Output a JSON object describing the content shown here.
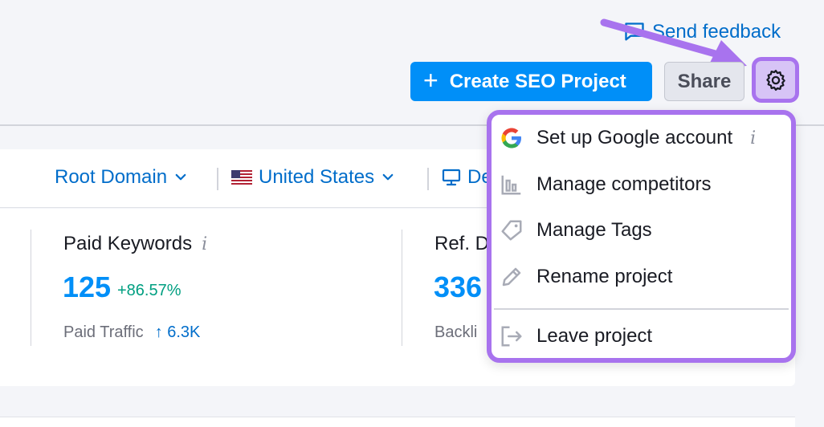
{
  "header": {
    "feedback_label": "Send feedback",
    "create_label": "Create SEO Project",
    "share_label": "Share"
  },
  "filters": {
    "root_domain": "Root Domain",
    "country": "United States",
    "device": "De"
  },
  "metrics": {
    "paid_keywords": {
      "title": "Paid Keywords",
      "info": "i",
      "value": "125",
      "change": "+86.57%",
      "sub_label": "Paid Traffic",
      "sub_arrow": "↑",
      "sub_value": "6.3K"
    },
    "ref_domains": {
      "title": "Ref. D",
      "value": "336",
      "sub_label": "Backli"
    }
  },
  "menu": {
    "items": [
      {
        "label": "Set up Google account",
        "icon": "google-icon",
        "info": "i"
      },
      {
        "label": "Manage competitors",
        "icon": "bar-chart-icon"
      },
      {
        "label": "Manage Tags",
        "icon": "tag-icon"
      },
      {
        "label": "Rename project",
        "icon": "pencil-icon"
      },
      {
        "label": "Leave project",
        "icon": "exit-icon"
      }
    ]
  },
  "colors": {
    "accent_purple": "#a873ee",
    "primary_blue": "#008ff8",
    "link_blue": "#006dca",
    "positive_green": "#009f81"
  }
}
